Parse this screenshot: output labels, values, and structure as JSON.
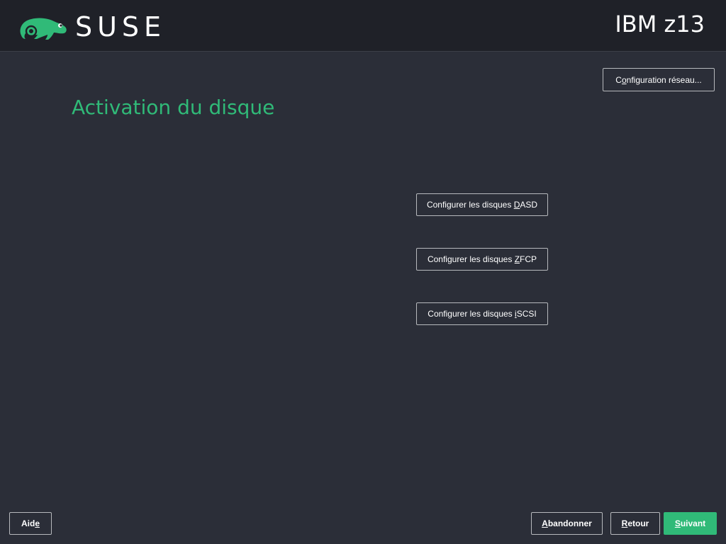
{
  "header": {
    "brand": "SUSE",
    "machine": "IBM z13",
    "logo_icon": "suse-chameleon-icon",
    "logo_color": "#30ba78"
  },
  "page": {
    "title": "Activation du disque"
  },
  "network_button": {
    "pre": "C",
    "mnemonic": "o",
    "post": "nfiguration réseau..."
  },
  "disk_buttons": [
    {
      "pre": "Configurer les disques ",
      "mnemonic": "D",
      "post": "ASD"
    },
    {
      "pre": "Configurer les disques ",
      "mnemonic": "Z",
      "post": "FCP"
    },
    {
      "pre": "Configurer les disques ",
      "mnemonic": "i",
      "post": "SCSI"
    }
  ],
  "footer": {
    "help": {
      "pre": "Aid",
      "mnemonic": "e",
      "post": ""
    },
    "abort": {
      "pre": "",
      "mnemonic": "A",
      "post": "bandonner"
    },
    "back": {
      "pre": "",
      "mnemonic": "R",
      "post": "etour"
    },
    "next": {
      "pre": "",
      "mnemonic": "S",
      "post": "uivant"
    }
  },
  "colors": {
    "background": "#2b2e38",
    "header": "#1f2128",
    "accent": "#30ba78",
    "button_border": "#b7b9bd"
  }
}
